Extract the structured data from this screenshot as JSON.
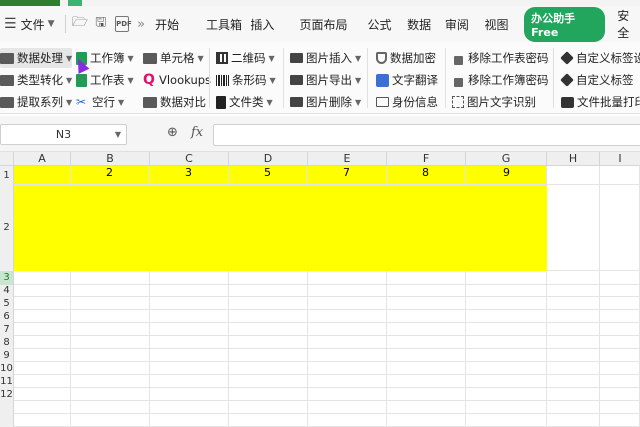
{
  "menubar": {
    "file_label": "文件",
    "pdf_label": "PDF",
    "more": "»",
    "tabs": [
      "开始",
      "工具箱",
      "插入",
      "页面布局",
      "公式",
      "数据",
      "审阅",
      "视图"
    ],
    "promo": "办公助手Free",
    "last_tab": "安全"
  },
  "ribbon": {
    "col1": [
      "数据处理",
      "类型转化",
      "提取系列"
    ],
    "col2": [
      "工作簿",
      "工作表",
      "空行"
    ],
    "col3": [
      "单元格",
      "Vlookups",
      "数据对比"
    ],
    "col4": [
      "二维码",
      "条形码",
      "文件类"
    ],
    "col5": [
      "图片插入",
      "图片导出",
      "图片删除"
    ],
    "col6": [
      "数据加密",
      "文字翻译",
      "身份信息"
    ],
    "col7": [
      "移除工作表密码",
      "移除工作簿密码",
      "图片文字识别"
    ],
    "col8": [
      "自定义标签设",
      "自定义标签",
      "文件批量打印"
    ]
  },
  "formula_bar": {
    "name_box": "N3",
    "fx": "fx",
    "value": ""
  },
  "sheet": {
    "columns": [
      "A",
      "B",
      "C",
      "D",
      "E",
      "F",
      "G",
      "H",
      "I"
    ],
    "rows": [
      "1",
      "2",
      "3",
      "4",
      "5",
      "6",
      "7",
      "8",
      "9",
      "10",
      "11",
      "12"
    ],
    "row1_values": [
      "",
      "2",
      "3",
      "5",
      "7",
      "8",
      "9",
      "",
      ""
    ],
    "selected_cell": "N3",
    "fill_color": "#ffff00"
  },
  "colors": {
    "accent": "#22a55c",
    "selection": "#c9e6cf"
  }
}
